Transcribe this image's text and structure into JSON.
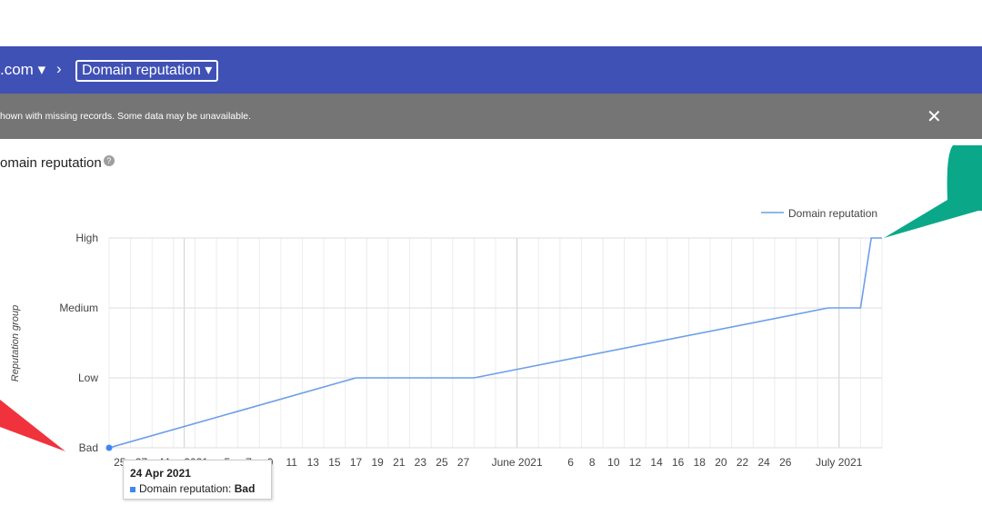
{
  "header": {
    "crumb_domain": ".com",
    "crumb_separator": "›",
    "crumb_page": "Domain reputation"
  },
  "notice": {
    "text": "hown with missing records. Some data may be unavailable.",
    "close": "✕"
  },
  "section": {
    "title": "omain reputation",
    "help": "?"
  },
  "tooltip": {
    "date": "24 Apr 2021",
    "series": "Domain reputation: ",
    "value": "Bad"
  },
  "colors": {
    "header": "#3f51b5",
    "notice": "#757575",
    "line": "#6d9eeb",
    "callout": "#0aa889",
    "arrow": "#f0323c"
  },
  "chart_data": {
    "type": "line",
    "ylabel": "Reputation group",
    "y_categories": [
      "Bad",
      "Low",
      "Medium",
      "High"
    ],
    "legend": "Domain reputation",
    "legend_position": "top-right",
    "x_range": [
      "2021-04-24",
      "2021-07-05"
    ],
    "x_tick_labels": [
      [
        "2021-04-25",
        "25"
      ],
      [
        "2021-04-27",
        "27"
      ],
      [
        "2021-05-01",
        "May 2021"
      ],
      [
        "2021-05-05",
        "5"
      ],
      [
        "2021-05-07",
        "7"
      ],
      [
        "2021-05-09",
        "9"
      ],
      [
        "2021-05-11",
        "11"
      ],
      [
        "2021-05-13",
        "13"
      ],
      [
        "2021-05-15",
        "15"
      ],
      [
        "2021-05-17",
        "17"
      ],
      [
        "2021-05-19",
        "19"
      ],
      [
        "2021-05-21",
        "21"
      ],
      [
        "2021-05-23",
        "23"
      ],
      [
        "2021-05-25",
        "25"
      ],
      [
        "2021-05-27",
        "27"
      ],
      [
        "2021-06-01",
        "June 2021"
      ],
      [
        "2021-06-06",
        "6"
      ],
      [
        "2021-06-08",
        "8"
      ],
      [
        "2021-06-10",
        "10"
      ],
      [
        "2021-06-12",
        "12"
      ],
      [
        "2021-06-14",
        "14"
      ],
      [
        "2021-06-16",
        "16"
      ],
      [
        "2021-06-18",
        "18"
      ],
      [
        "2021-06-20",
        "20"
      ],
      [
        "2021-06-22",
        "22"
      ],
      [
        "2021-06-24",
        "24"
      ],
      [
        "2021-06-26",
        "26"
      ],
      [
        "2021-07-01",
        "July 2021"
      ]
    ],
    "series": [
      {
        "name": "Domain reputation",
        "points": [
          [
            "2021-04-24",
            "Bad"
          ],
          [
            "2021-05-17",
            "Low"
          ],
          [
            "2021-05-28",
            "Low"
          ],
          [
            "2021-06-30",
            "Medium"
          ],
          [
            "2021-07-03",
            "Medium"
          ],
          [
            "2021-07-04",
            "High"
          ],
          [
            "2021-07-05",
            "High"
          ]
        ]
      }
    ],
    "grid": true
  }
}
